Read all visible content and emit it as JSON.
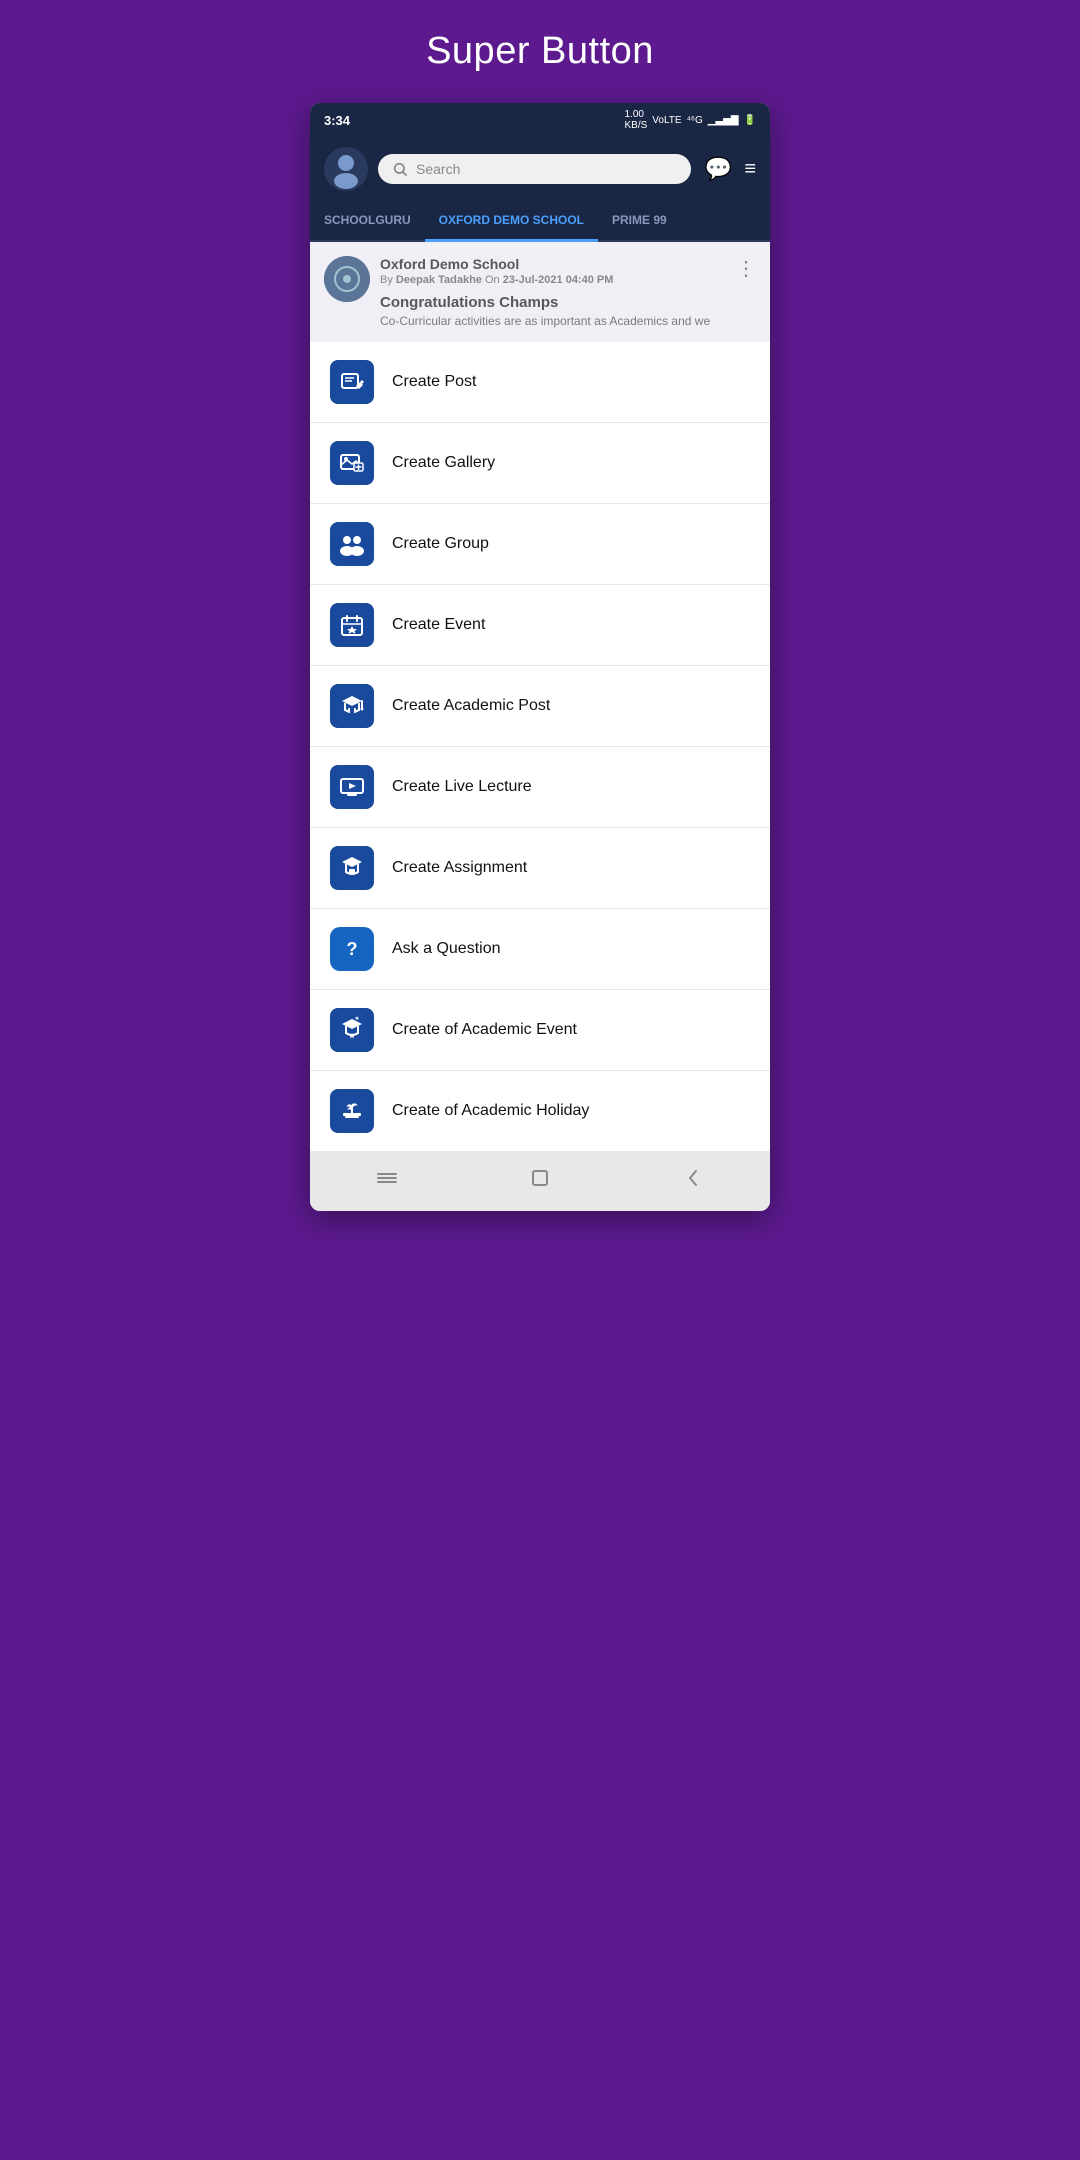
{
  "page": {
    "title": "Super Button"
  },
  "status_bar": {
    "time": "3:34",
    "network": "1.00 KB/S",
    "type": "VoLTE",
    "signal": "4G"
  },
  "app_bar": {
    "search_placeholder": "Search"
  },
  "tabs": [
    {
      "label": "SCHOOLGURU",
      "active": false
    },
    {
      "label": "OXFORD DEMO SCHOOL",
      "active": true
    },
    {
      "label": "PRIME 99",
      "active": false
    }
  ],
  "post": {
    "school": "Oxford Demo School",
    "author": "Deepak Tadakhe",
    "date": "23-Jul-2021 04:40 PM",
    "title": "Congratulations Champs",
    "body": "Co-Curricular activities are as important as Academics and we"
  },
  "menu_items": [
    {
      "id": "create-post",
      "label": "Create Post"
    },
    {
      "id": "create-gallery",
      "label": "Create Gallery"
    },
    {
      "id": "create-group",
      "label": "Create Group"
    },
    {
      "id": "create-event",
      "label": "Create Event"
    },
    {
      "id": "create-academic-post",
      "label": "Create Academic Post"
    },
    {
      "id": "create-live-lecture",
      "label": "Create Live Lecture"
    },
    {
      "id": "create-assignment",
      "label": "Create Assignment"
    },
    {
      "id": "ask-question",
      "label": "Ask a Question"
    },
    {
      "id": "create-academic-event",
      "label": "Create of Academic Event"
    },
    {
      "id": "create-academic-holiday",
      "label": "Create of Academic Holiday"
    }
  ],
  "colors": {
    "icon_bg": "#1a4a9e",
    "active_tab": "#4a9fff",
    "purple_bg": "#5c1a8e"
  }
}
